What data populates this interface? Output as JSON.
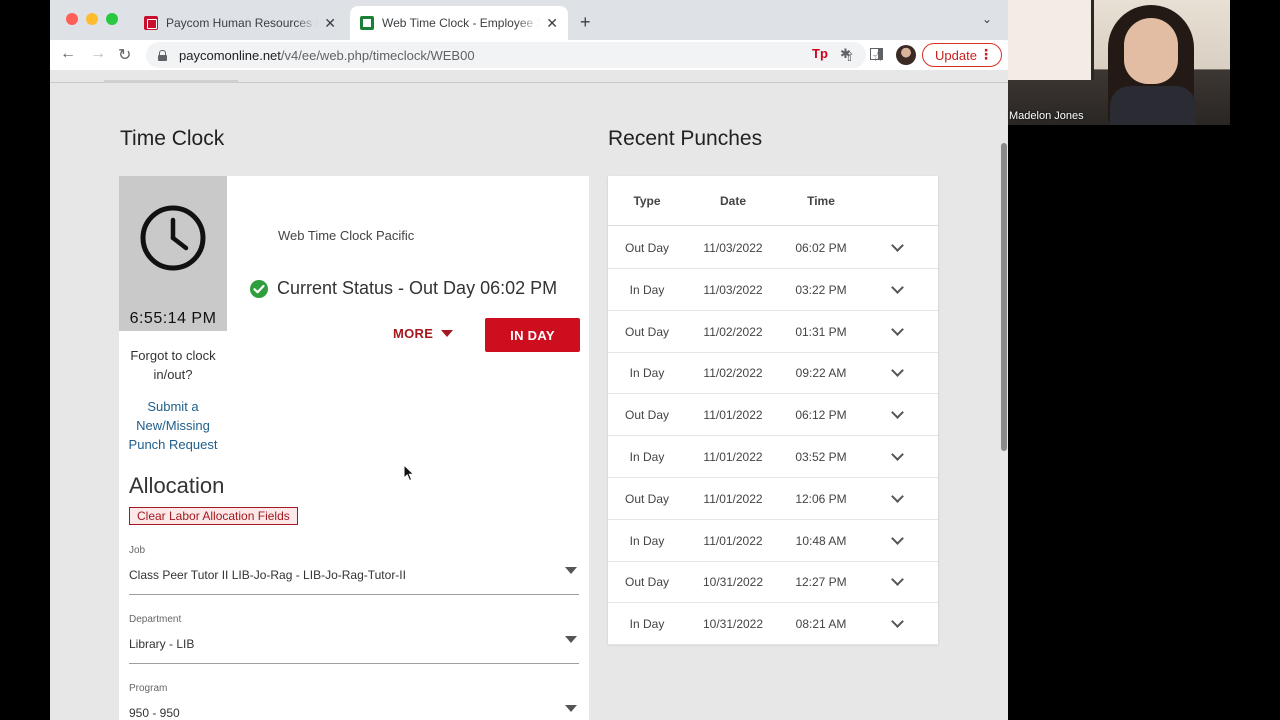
{
  "browser": {
    "tabs": [
      {
        "title": "Paycom Human Resources Info",
        "favicon": "paycom-icon",
        "active": false
      },
      {
        "title": "Web Time Clock - Employee Se",
        "favicon": "timeclock-icon",
        "active": true
      }
    ],
    "close_glyph": "✕",
    "new_tab_glyph": "+",
    "tab_list_glyph": "⌄",
    "url_host": "paycomonline.net",
    "url_path": "/v4/ee/web.php/timeclock/WEB00",
    "toolbar_glyphs": {
      "back": "←",
      "forward": "→",
      "reload": "↻",
      "share": "⇧",
      "star": "☆",
      "extensions": "✱"
    },
    "ext_label": "Tp",
    "update_label": "Update",
    "menu_glyph": "⋮"
  },
  "time_clock": {
    "heading": "Time Clock",
    "clock_time": "6:55:14 PM",
    "location": "Web Time Clock Pacific",
    "status": "Current Status - Out Day 06:02 PM",
    "more_label": "MORE",
    "in_day_label": "IN DAY",
    "forgot_text": "Forgot to clock in/out?",
    "submit_link": "Submit a New/Missing Punch Request"
  },
  "allocation": {
    "heading": "Allocation",
    "clear_label": "Clear Labor Allocation Fields",
    "fields": [
      {
        "label": "Job",
        "value": "Class Peer Tutor II LIB-Jo-Rag - LIB-Jo-Rag-Tutor-II"
      },
      {
        "label": "Department",
        "value": "Library - LIB"
      },
      {
        "label": "Program",
        "value": "950 - 950"
      }
    ]
  },
  "recent_punches": {
    "heading": "Recent Punches",
    "columns": [
      "Type",
      "Date",
      "Time"
    ],
    "rows": [
      {
        "type": "Out Day",
        "date": "11/03/2022",
        "time": "06:02 PM"
      },
      {
        "type": "In Day",
        "date": "11/03/2022",
        "time": "03:22 PM"
      },
      {
        "type": "Out Day",
        "date": "11/02/2022",
        "time": "01:31 PM"
      },
      {
        "type": "In Day",
        "date": "11/02/2022",
        "time": "09:22 AM"
      },
      {
        "type": "Out Day",
        "date": "11/01/2022",
        "time": "06:12 PM"
      },
      {
        "type": "In Day",
        "date": "11/01/2022",
        "time": "03:52 PM"
      },
      {
        "type": "Out Day",
        "date": "11/01/2022",
        "time": "12:06 PM"
      },
      {
        "type": "In Day",
        "date": "11/01/2022",
        "time": "10:48 AM"
      },
      {
        "type": "Out Day",
        "date": "10/31/2022",
        "time": "12:27 PM"
      },
      {
        "type": "In Day",
        "date": "10/31/2022",
        "time": "08:21 AM"
      }
    ]
  },
  "video": {
    "participant_name": "Madelon Jones"
  },
  "colors": {
    "accent_red": "#cc0e1e",
    "link_blue": "#1f5e8c",
    "status_green": "#2e9e3e"
  }
}
